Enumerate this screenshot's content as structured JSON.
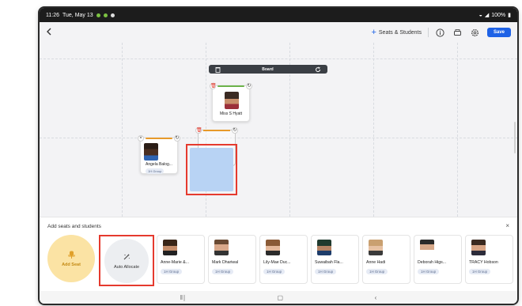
{
  "status_bar": {
    "time": "11:26",
    "date": "Tue, May 13",
    "battery": "100%"
  },
  "toolbar": {
    "back_icon": "chevron-left-icon",
    "seats_students_label": "Seats & Students",
    "save_label": "Save"
  },
  "board": {
    "label": "Board"
  },
  "seats": [
    {
      "name": "Miss S Hyatt",
      "chip": "",
      "accent": "#6cb24a"
    },
    {
      "name": "Angela Balog...",
      "chip": "1H Group",
      "accent": "#e79a2a"
    }
  ],
  "panel": {
    "title": "Add seats and students",
    "add_seat_label": "Add Seat",
    "auto_allocate_label": "Auto Allocate",
    "students": [
      {
        "name": "Anne-Marie &...",
        "group": "1H Group"
      },
      {
        "name": "Mark Dhariwal",
        "group": "1H Group"
      },
      {
        "name": "Lily-Mae Duc...",
        "group": "1H Group"
      },
      {
        "name": "Suwaibah Fla...",
        "group": "1H Group"
      },
      {
        "name": "Anne Hadi",
        "group": "1H Group"
      },
      {
        "name": "Deborah Higs...",
        "group": "1H Group"
      },
      {
        "name": "TRACY Hobson",
        "group": "1H Group"
      }
    ]
  },
  "colors": {
    "accent": "#1e62e6",
    "highlight": "#e53a2e",
    "add_seat_bg": "#fbe3a4"
  }
}
